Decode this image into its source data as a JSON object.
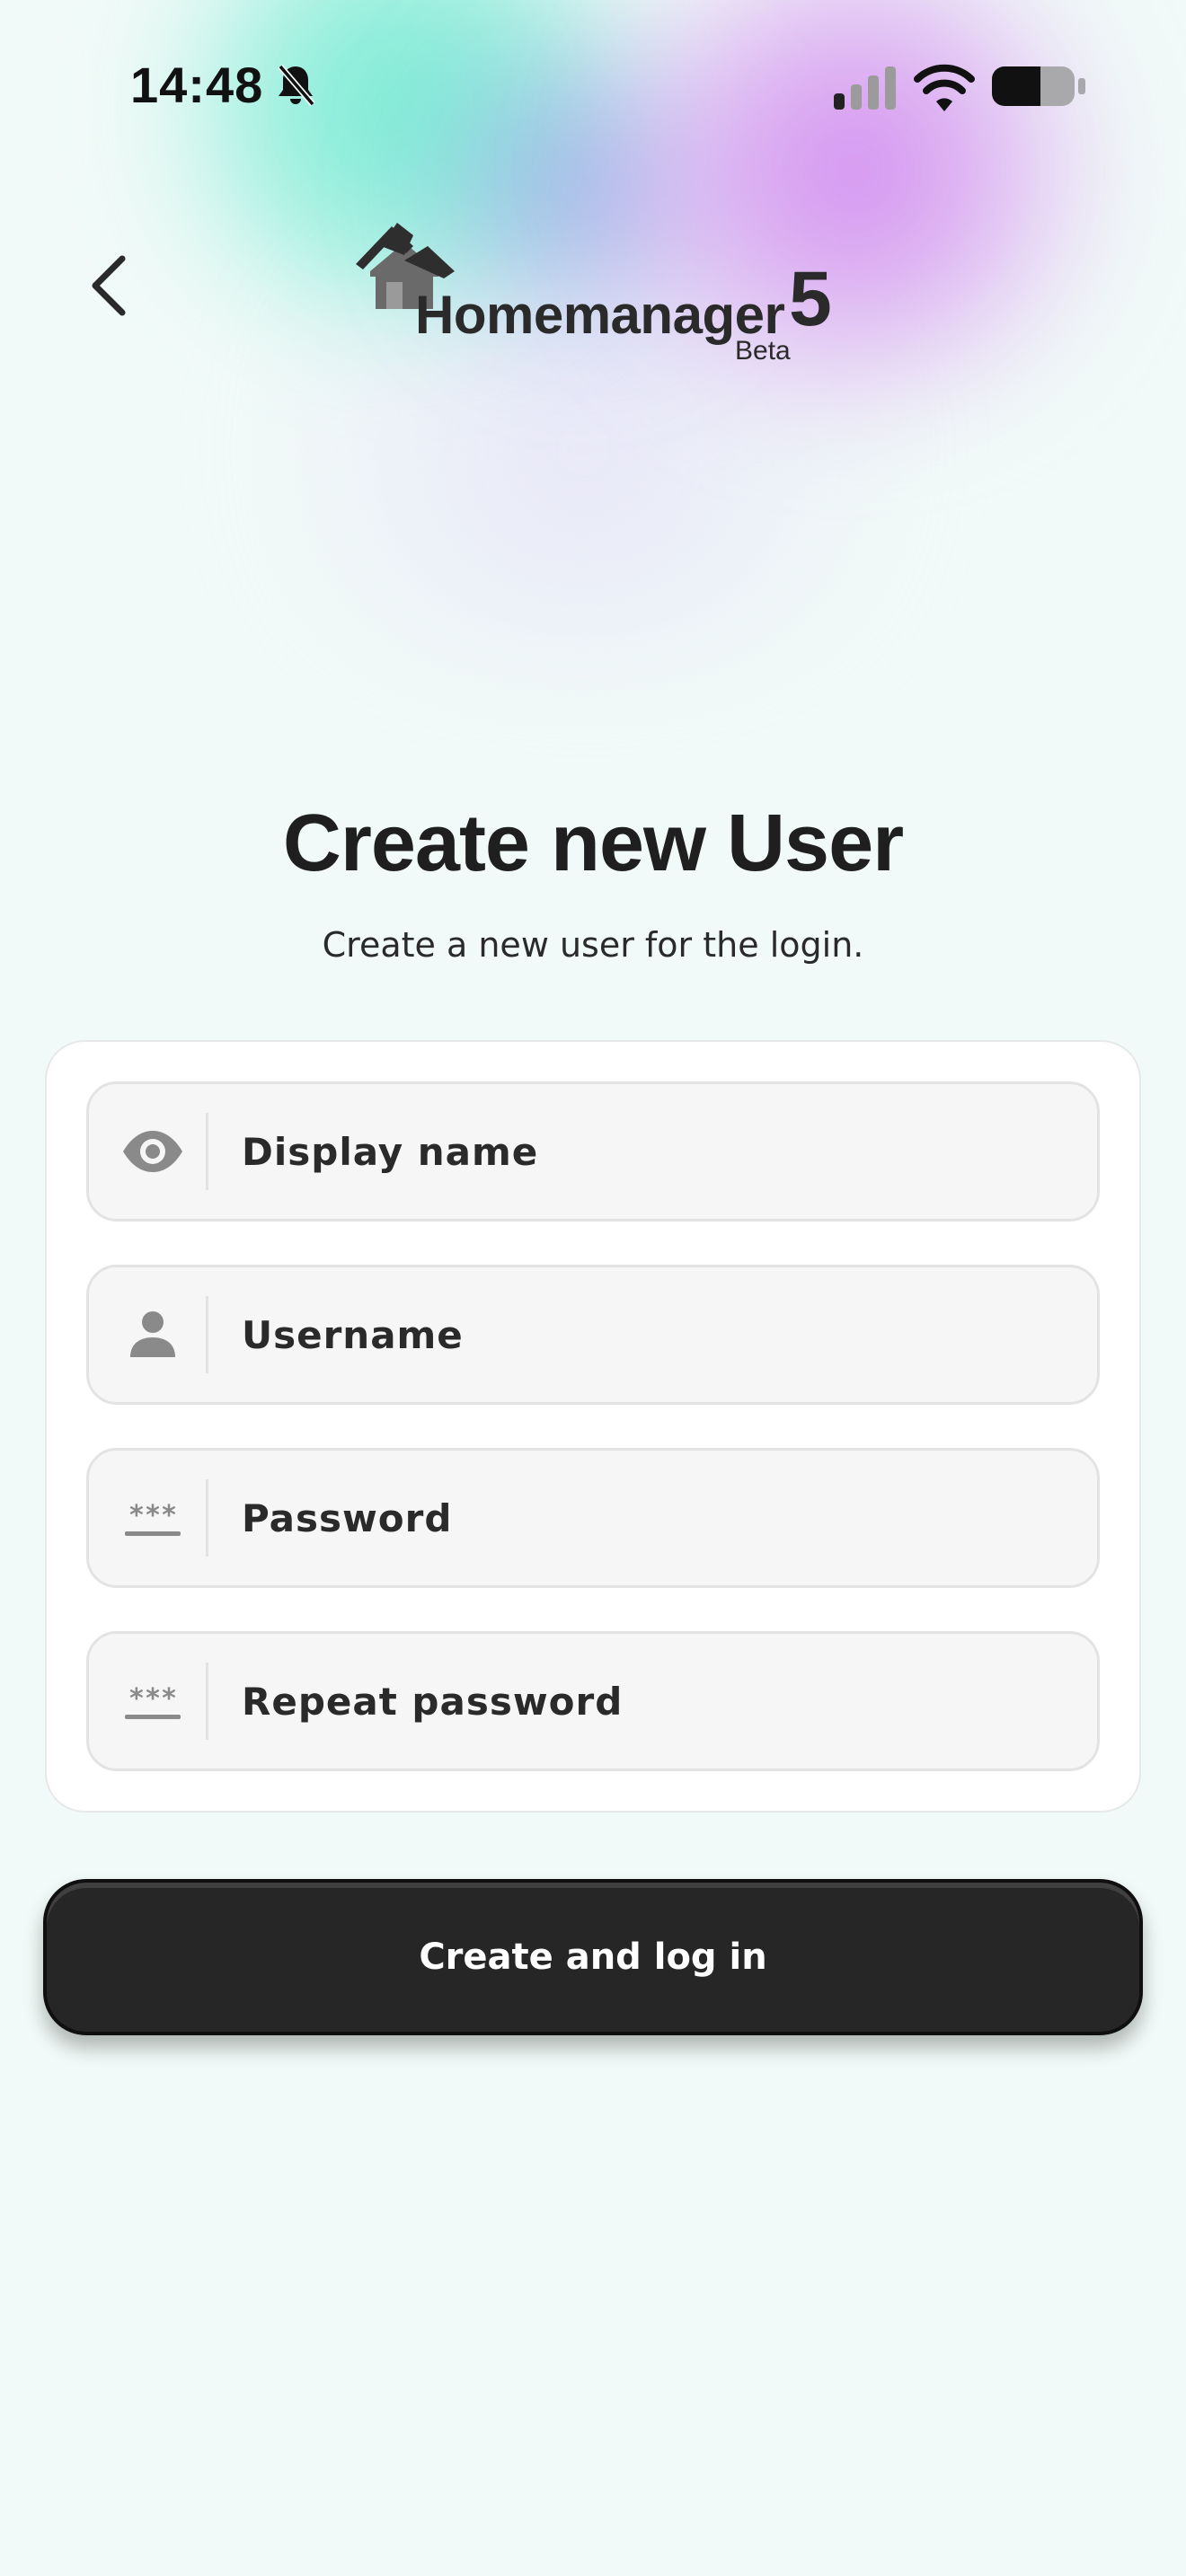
{
  "status_bar": {
    "time": "14:48",
    "icons": [
      "bell-slash-icon",
      "cellular-signal-icon",
      "wifi-icon",
      "battery-icon"
    ]
  },
  "header": {
    "back_icon": "chevron-left-icon",
    "logo": {
      "name": "Homemanager",
      "version": "5",
      "badge": "Beta"
    }
  },
  "main": {
    "title": "Create new User",
    "subtitle": "Create a new user for the login."
  },
  "form": {
    "fields": [
      {
        "icon": "eye-icon",
        "placeholder": "Display name",
        "value": ""
      },
      {
        "icon": "person-icon",
        "placeholder": "Username",
        "value": ""
      },
      {
        "icon": "password-icon",
        "placeholder": "Password",
        "value": ""
      },
      {
        "icon": "password-icon",
        "placeholder": "Repeat password",
        "value": ""
      }
    ],
    "submit_label": "Create and log in"
  },
  "colors": {
    "background": "#f1faf8",
    "button": "#262626",
    "accent_teal": "#62e8cd",
    "accent_purple": "#cf80ee",
    "icon_gray": "#8a8a8a"
  }
}
